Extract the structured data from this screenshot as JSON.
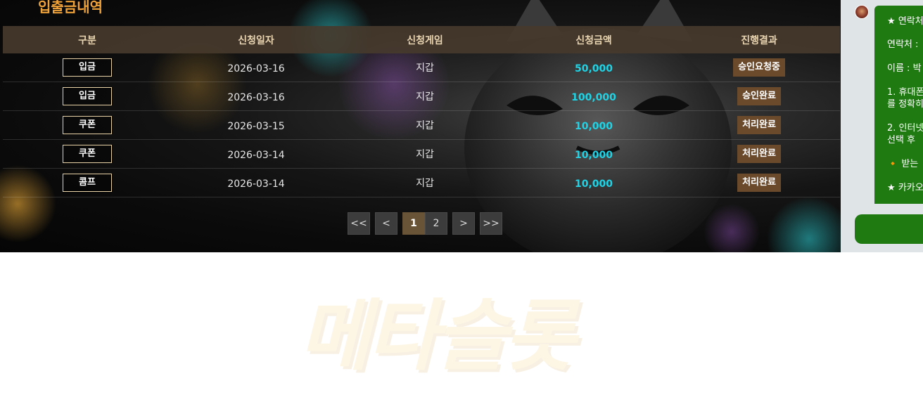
{
  "page": {
    "section_title": "입출금내역"
  },
  "table": {
    "headers": [
      "구분",
      "신청일자",
      "신청게임",
      "신청금액",
      "진행결과"
    ],
    "rows": [
      {
        "type": "입금",
        "date": "2026-03-16",
        "game": "지갑",
        "amount": "50,000",
        "status": "승인요청중"
      },
      {
        "type": "입금",
        "date": "2026-03-16",
        "game": "지갑",
        "amount": "100,000",
        "status": "승인완료"
      },
      {
        "type": "쿠폰",
        "date": "2026-03-15",
        "game": "지갑",
        "amount": "10,000",
        "status": "처리완료"
      },
      {
        "type": "쿠폰",
        "date": "2026-03-14",
        "game": "지갑",
        "amount": "10,000",
        "status": "처리완료"
      },
      {
        "type": "콤프",
        "date": "2026-03-14",
        "game": "지갑",
        "amount": "10,000",
        "status": "처리완료"
      }
    ]
  },
  "pagination": {
    "first": "<<",
    "prev": "<",
    "pages": [
      "1",
      "2"
    ],
    "current": "1",
    "next": ">",
    "last": ">>"
  },
  "watermark": {
    "text": "메타슬롯"
  },
  "chat": {
    "lines": [
      "★ 연락처",
      "연락처 :",
      "이름 : 박",
      "1. 휴대폰",
      "를 정확히",
      "2. 인터넷",
      "선택 후",
      "🔸 받는",
      "★ 카카오"
    ]
  },
  "colors": {
    "accent_orange": "#f0a23a",
    "amount_cyan": "#1fd4e6",
    "status_brown": "#6b4a2c",
    "chat_green": "#1f7a12"
  }
}
